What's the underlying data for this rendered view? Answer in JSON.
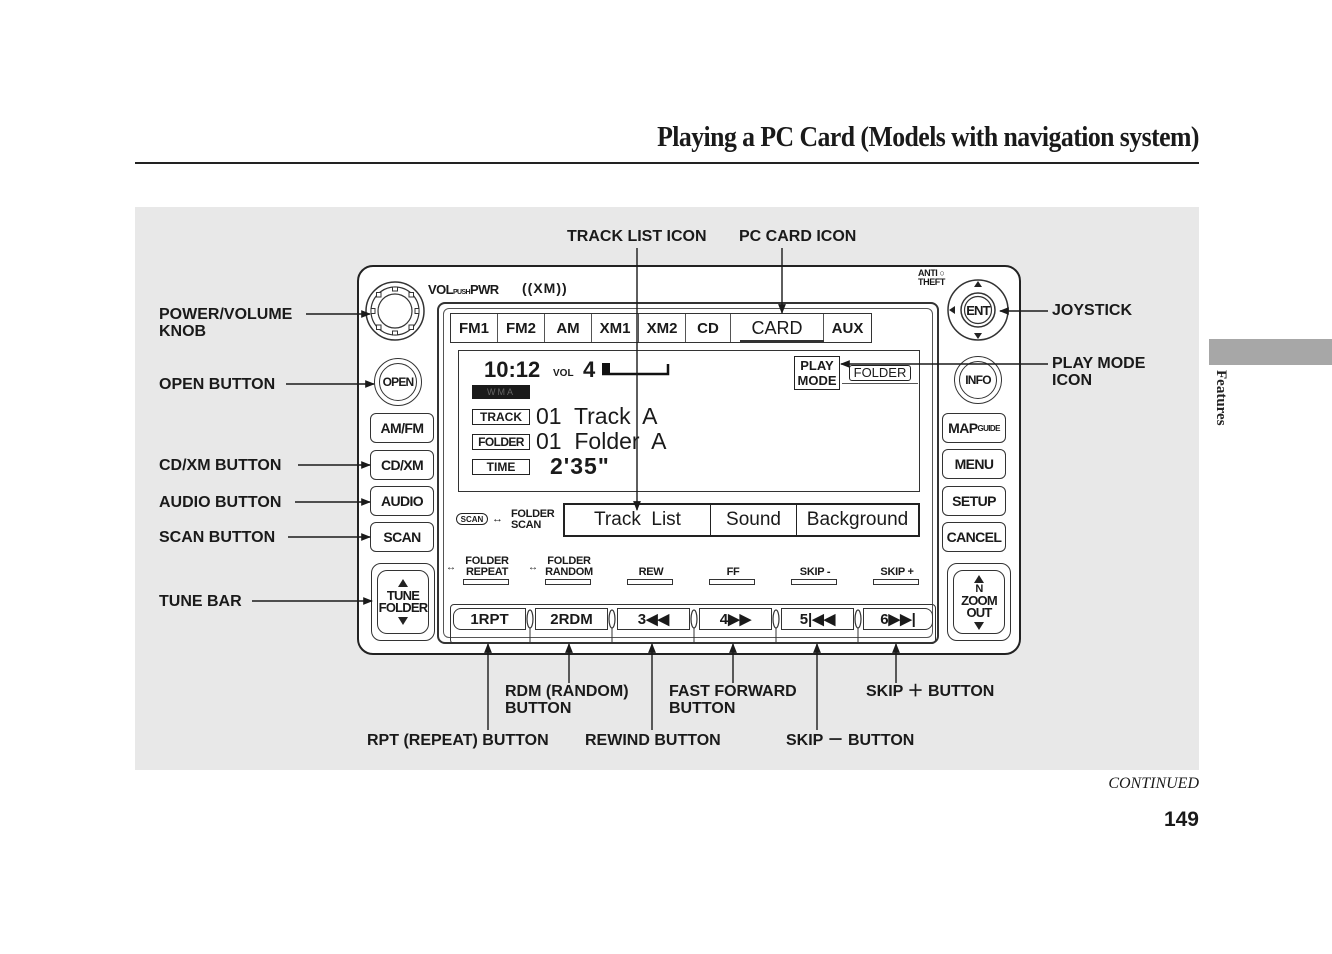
{
  "page": {
    "title": "Playing a PC Card (Models with navigation system)",
    "section_tab": "Features",
    "continued": "CONTINUED",
    "page_number": "149"
  },
  "callouts": {
    "track_list_icon": "TRACK LIST ICON",
    "pc_card_icon": "PC CARD ICON",
    "power_volume_knob_1": "POWER/VOLUME",
    "power_volume_knob_2": "KNOB",
    "open_button": "OPEN BUTTON",
    "cd_xm_button": "CD/XM BUTTON",
    "audio_button": "AUDIO BUTTON",
    "scan_button": "SCAN BUTTON",
    "tune_bar": "TUNE BAR",
    "joystick": "JOYSTICK",
    "play_mode_icon_1": "PLAY MODE",
    "play_mode_icon_2": "ICON",
    "rdm_button_1": "RDM (RANDOM)",
    "rdm_button_2": "BUTTON",
    "fast_forward_button_1": "FAST FORWARD",
    "fast_forward_button_2": "BUTTON",
    "skip_plus_button": "SKIP ＋ BUTTON",
    "rpt_button": "RPT (REPEAT) BUTTON",
    "rewind_button": "REWIND BUTTON",
    "skip_minus_button": "SKIP － BUTTON"
  },
  "unit": {
    "vol_label": "VOL",
    "push_label": "PUSH",
    "pwr_label": "PWR",
    "xm_logo": "((XM))",
    "anti_theft_1": "ANTI",
    "anti_theft_2": "THEFT",
    "source_tabs": [
      {
        "label": "FM1"
      },
      {
        "label": "FM2"
      },
      {
        "label": "AM"
      },
      {
        "label": "XM1"
      },
      {
        "label": "XM2"
      },
      {
        "label": "CD"
      },
      {
        "label": "CARD",
        "active": true
      },
      {
        "label": "AUX"
      }
    ],
    "screen": {
      "clock": "10:12",
      "vol_label": "VOL",
      "vol_value": "4",
      "wma_badge": "WMA",
      "track_tag": "TRACK",
      "track_value": "01  Track  A",
      "folder_tag": "FOLDER",
      "folder_value": "01  Folder  A",
      "time_tag": "TIME",
      "time_value": "2'35\"",
      "play_mode_1": "PLAY",
      "play_mode_2": "MODE",
      "play_mode_value": "FOLDER",
      "scan_tag": "SCAN",
      "folder_scan_1": "FOLDER",
      "folder_scan_2": "SCAN"
    },
    "soft_buttons": [
      "Track  List",
      "Sound",
      "Background"
    ],
    "function_labels": [
      {
        "line1": "FOLDER",
        "line2": "REPEAT"
      },
      {
        "line1": "FOLDER",
        "line2": "RANDOM"
      },
      {
        "line1": "",
        "line2": "REW"
      },
      {
        "line1": "",
        "line2": "FF"
      },
      {
        "line1": "",
        "line2": "SKIP -"
      },
      {
        "line1": "",
        "line2": "SKIP +"
      }
    ],
    "presets": [
      "1RPT",
      "2RDM",
      "3◀◀",
      "4▶▶",
      "5|◀◀",
      "6▶▶|"
    ],
    "left_buttons": {
      "open": "OPEN",
      "am_fm": "AM/FM",
      "cd_xm": "CD/XM",
      "audio": "AUDIO",
      "scan": "SCAN",
      "tune_1": "TUNE",
      "tune_2": "FOLDER"
    },
    "right_buttons": {
      "ent": "ENT",
      "info": "INFO",
      "map_guide_1": "MAP",
      "map_guide_2": "GUIDE",
      "menu": "MENU",
      "setup": "SETUP",
      "cancel": "CANCEL",
      "zoom_n": "N",
      "zoom_1": "ZOOM",
      "zoom_2": "OUT"
    }
  },
  "colors": {
    "panel_bg": "#e8e8e8",
    "section_tab": "#a7a7a7",
    "ink": "#1a1a1a"
  }
}
